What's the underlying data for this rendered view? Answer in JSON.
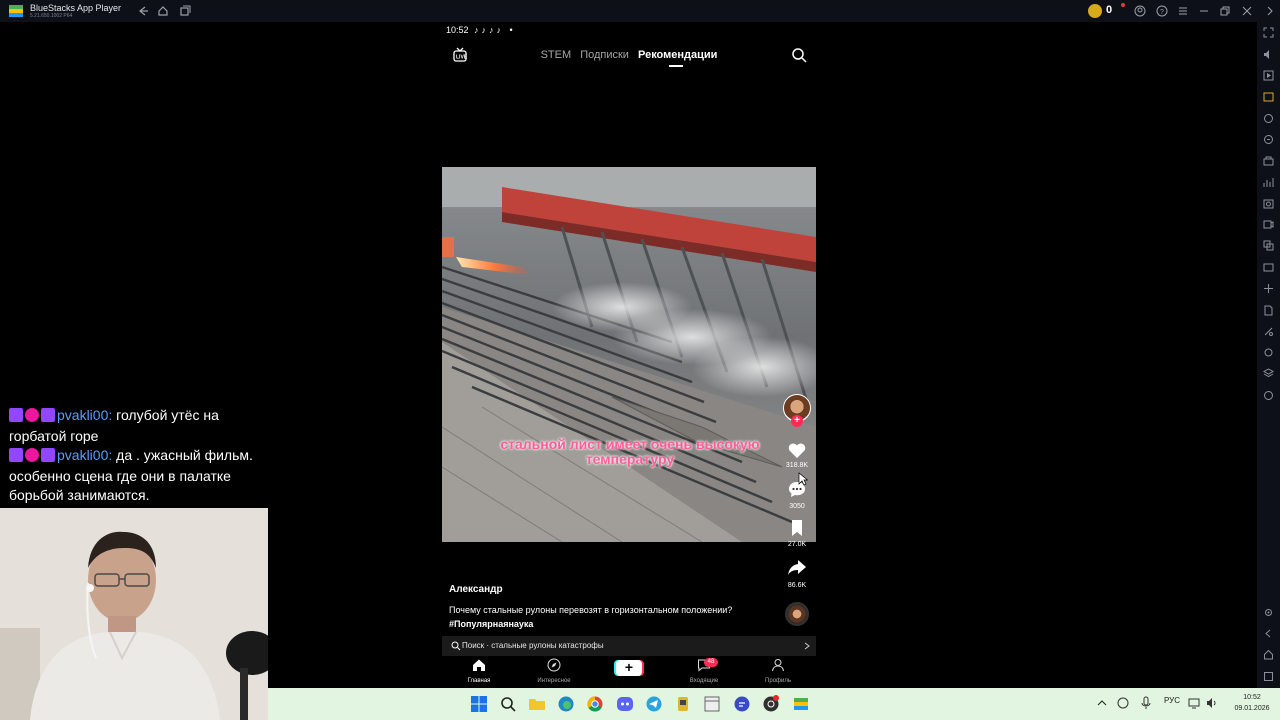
{
  "window": {
    "title": "BlueStacks App Player",
    "version": "5.21.650.1002 P64",
    "coin_count": "0"
  },
  "phone": {
    "status_time": "10:52",
    "tabs": {
      "stem": "STEM",
      "subscriptions": "Подписки",
      "recommendations": "Рекомендации"
    },
    "video": {
      "caption": "стальной лист имеет очень высокую температуру",
      "likes": "318.8K",
      "comments": "3050",
      "bookmarks": "27.0K",
      "shares": "86.6K"
    },
    "author": "Александр",
    "description": "Почему стальные рулоны перевозят в горизонтальном положении?",
    "hashtag": "#Популярнаянаука",
    "search_bar": "Поиск · стальные рулоны катастрофы",
    "bottom_nav": {
      "home": "Главная",
      "discover": "Интересное",
      "inbox": "Входящие",
      "inbox_badge": "48",
      "profile": "Профиль"
    }
  },
  "chat": {
    "messages": [
      {
        "user": "pvakli00:",
        "text": " голубой утёс на горбатой горе"
      },
      {
        "user": "pvakli00:",
        "text": " да . ужасный фильм. особенно сцена где они в палатке борьбой занимаются."
      }
    ]
  },
  "taskbar": {
    "language": "РУС",
    "time": "10:52",
    "date": "09.01.2026"
  },
  "colors": {
    "accent_pink": "#fe2c55",
    "accent_cyan": "#25f4ee",
    "chat_user": "#5c9bff",
    "taskbar_bg": "#e1f5e1"
  }
}
